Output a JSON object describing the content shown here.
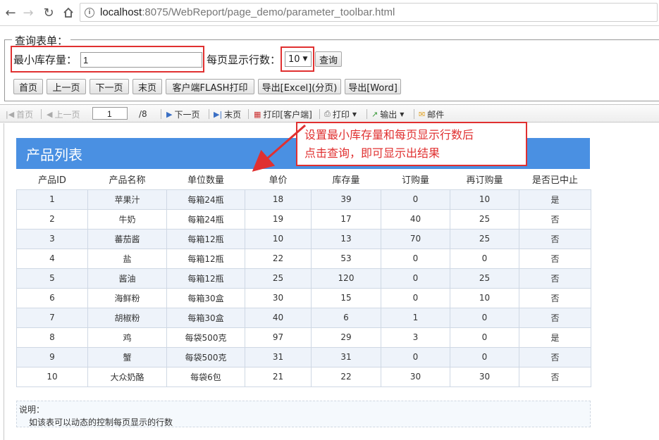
{
  "browser": {
    "url_host": "localhost",
    "url_rest": ":8075/WebReport/page_demo/parameter_toolbar.html"
  },
  "form": {
    "legend": "查询表单：",
    "min_stock_label": "最小库存量：",
    "min_stock_value": "1",
    "rows_label": "每页显示行数：",
    "rows_value": "10",
    "query_button": "查询",
    "buttons": [
      "首页",
      "上一页",
      "下一页",
      "末页",
      "客户端FLASH打印",
      "导出[Excel](分页)",
      "导出[Word]"
    ]
  },
  "toolbar": {
    "first": "首页",
    "prev": "上一页",
    "page_value": "1",
    "page_total": "/8",
    "next": "下一页",
    "last": "末页",
    "print_client": "打印[客户端]",
    "print": "打印",
    "export": "输出",
    "mail": "邮件"
  },
  "annotation": {
    "line1": "设置最小库存量和每页显示行数后",
    "line2": "点击查询，即可显示出结果"
  },
  "report": {
    "title": "产品列表",
    "columns": [
      "产品ID",
      "产品名称",
      "单位数量",
      "单价",
      "库存量",
      "订购量",
      "再订购量",
      "是否已中止"
    ],
    "rows": [
      [
        "1",
        "苹果汁",
        "每箱24瓶",
        "18",
        "39",
        "0",
        "10",
        "是"
      ],
      [
        "2",
        "牛奶",
        "每箱24瓶",
        "19",
        "17",
        "40",
        "25",
        "否"
      ],
      [
        "3",
        "蕃茄酱",
        "每箱12瓶",
        "10",
        "13",
        "70",
        "25",
        "否"
      ],
      [
        "4",
        "盐",
        "每箱12瓶",
        "22",
        "53",
        "0",
        "0",
        "否"
      ],
      [
        "5",
        "酱油",
        "每箱12瓶",
        "25",
        "120",
        "0",
        "25",
        "否"
      ],
      [
        "6",
        "海鲜粉",
        "每箱30盒",
        "30",
        "15",
        "0",
        "10",
        "否"
      ],
      [
        "7",
        "胡椒粉",
        "每箱30盒",
        "40",
        "6",
        "1",
        "0",
        "否"
      ],
      [
        "8",
        "鸡",
        "每袋500克",
        "97",
        "29",
        "3",
        "0",
        "是"
      ],
      [
        "9",
        "蟹",
        "每袋500克",
        "31",
        "31",
        "0",
        "0",
        "否"
      ],
      [
        "10",
        "大众奶酪",
        "每袋6包",
        "21",
        "22",
        "30",
        "30",
        "否"
      ]
    ]
  },
  "notes": {
    "title": "说明：",
    "content": "如该表可以动态的控制每页显示的行数"
  },
  "colors": {
    "header_blue": "#4a90e2",
    "highlight_red": "#e03030"
  }
}
